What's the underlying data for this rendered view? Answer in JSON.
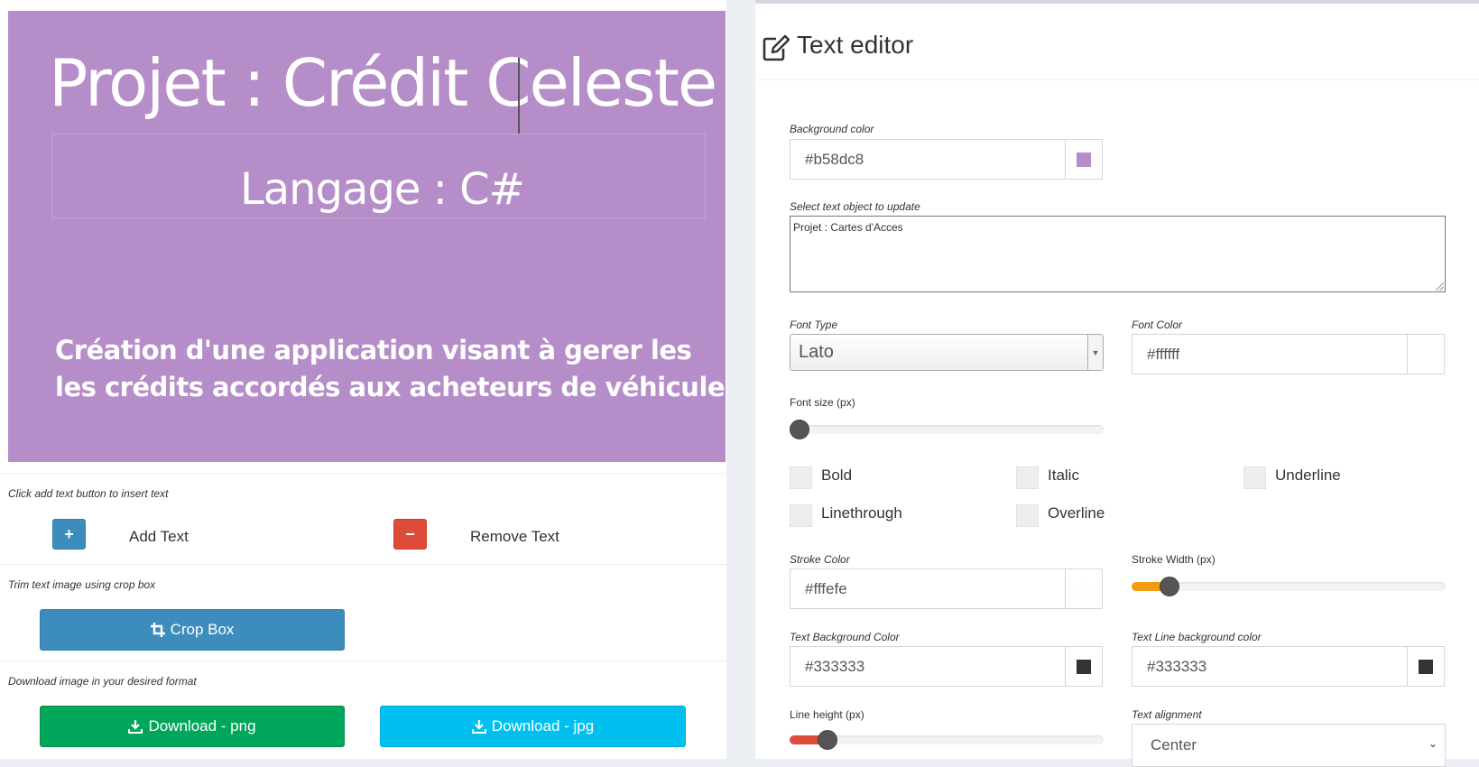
{
  "canvas": {
    "background_color": "#b58dc8",
    "title_text": "Projet : Crédit Celeste",
    "subtitle_text": "Langage : C#",
    "description_line1": "Création d'une application visant à gerer les",
    "description_line2": "les crédits accordés aux acheteurs de véhicules"
  },
  "left": {
    "add_hint": "Click add text button to insert text",
    "add_text_label": "Add Text",
    "remove_text_label": "Remove Text",
    "crop_hint": "Trim text image using crop box",
    "crop_label": "Crop Box",
    "download_hint": "Download image in your desired format",
    "download_png_label": "Download - png",
    "download_jpg_label": "Download - jpg"
  },
  "editor": {
    "title": "Text editor",
    "background_color_label": "Background color",
    "background_color_value": "#b58dc8",
    "select_object_label": "Select text object to update",
    "select_object_value": "Projet : Cartes d'Acces",
    "font_type_label": "Font Type",
    "font_type_value": "Lato",
    "font_color_label": "Font Color",
    "font_color_value": "#ffffff",
    "font_size_label": "Font size (px)",
    "font_size_level": 0,
    "checkboxes": {
      "bold": "Bold",
      "italic": "Italic",
      "underline": "Underline",
      "linethrough": "Linethrough",
      "overline": "Overline"
    },
    "stroke_color_label": "Stroke Color",
    "stroke_color_value": "#fffefe",
    "stroke_width_label": "Stroke Width (px)",
    "stroke_width_level": 0.09,
    "text_bg_color_label": "Text Background Color",
    "text_bg_color_value": "#333333",
    "text_line_bg_label": "Text Line background color",
    "text_line_bg_value": "#333333",
    "line_height_label": "Line height (px)",
    "line_height_level": 0.09,
    "text_alignment_label": "Text alignment",
    "text_alignment_value": "Center"
  },
  "colors": {
    "slider_orange": "#f39c12",
    "slider_red": "#dd4b39",
    "primary": "#3c8dbc",
    "danger": "#dd4b39",
    "success": "#00a65a",
    "info": "#00c0ef"
  }
}
